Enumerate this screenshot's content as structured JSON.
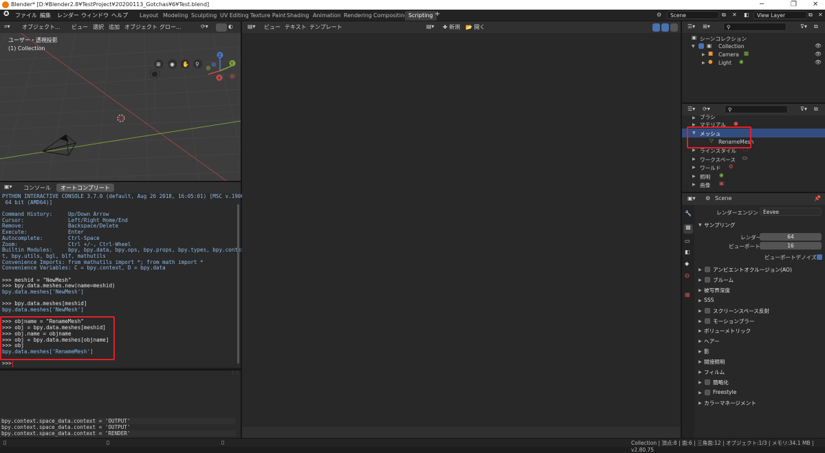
{
  "window": {
    "title": "Blender* [D:¥Blender2.8¥TestProject¥20200113_Gotchas¥6¥Test.blend]",
    "controls": [
      "─",
      "❐",
      "✕"
    ]
  },
  "menu": [
    "ファイル",
    "編集",
    "レンダー",
    "ウィンドウ",
    "ヘルプ"
  ],
  "workspaces": [
    "Layout",
    "Modeling",
    "Sculpting",
    "UV Editing",
    "Texture Paint",
    "Shading",
    "Animation",
    "Rendering",
    "Compositing",
    "Scripting"
  ],
  "active_workspace": "Scripting",
  "scene_field": "Scene",
  "view_layer_field": "View Layer",
  "viewport": {
    "mode": "オブジェクト...",
    "menus": [
      "ビュー",
      "選択",
      "追加",
      "オブジェクト"
    ],
    "transform": "グロー...",
    "title": "ユーザー・透視投影",
    "subtitle": "(1) Collection",
    "gizmo": {
      "x": "X",
      "y": "Y",
      "z": "Z"
    }
  },
  "console": {
    "tabs": [
      "コンソール",
      "オートコンプリート"
    ],
    "lines": [
      {
        "t": "PYTHON INTERACTIVE CONSOLE 3.7.0 (default, Aug 26 2018, 16:05:01) [MSC v.1900",
        "k": "o"
      },
      {
        "t": " 64 bit (AMD64)]",
        "k": "o"
      },
      {
        "t": "",
        "k": "o"
      },
      {
        "t": "Command History:     Up/Down Arrow",
        "k": "o"
      },
      {
        "t": "Cursor:              Left/Right Home/End",
        "k": "o"
      },
      {
        "t": "Remove:              Backspace/Delete",
        "k": "o"
      },
      {
        "t": "Execute:             Enter",
        "k": "o"
      },
      {
        "t": "Autocomplete:        Ctrl-Space",
        "k": "o"
      },
      {
        "t": "Zoom:                Ctrl +/-, Ctrl-Wheel",
        "k": "o"
      },
      {
        "t": "Builtin Modules:     bpy, bpy.data, bpy.ops, bpy.props, bpy.types, bpy.contex",
        "k": "o"
      },
      {
        "t": "t, bpy.utils, bgl, blf, mathutils",
        "k": "o"
      },
      {
        "t": "Convenience Imports: from mathutils import *; from math import *",
        "k": "o"
      },
      {
        "t": "Convenience Variables: C = bpy.context, D = bpy.data",
        "k": "o"
      },
      {
        "t": "",
        "k": "o"
      },
      {
        "t": ">>> meshid = \"NewMesh\"",
        "k": "i"
      },
      {
        "t": ">>> bpy.data.meshes.new(name=meshid)",
        "k": "i"
      },
      {
        "t": "bpy.data.meshes['NewMesh']",
        "k": "o"
      },
      {
        "t": "",
        "k": "o"
      },
      {
        "t": ">>> bpy.data.meshes[meshid]",
        "k": "i"
      },
      {
        "t": "bpy.data.meshes['NewMesh']",
        "k": "o"
      },
      {
        "t": "",
        "k": "o"
      },
      {
        "t": ">>> objname = \"RenameMesh\"",
        "k": "i"
      },
      {
        "t": ">>> obj = bpy.data.meshes[meshid]",
        "k": "i"
      },
      {
        "t": ">>> obj.name = objname",
        "k": "i"
      },
      {
        "t": ">>> obj = bpy.data.meshes[objname]",
        "k": "i"
      },
      {
        "t": ">>> obj",
        "k": "i"
      },
      {
        "t": "bpy.data.meshes['RenameMesh']",
        "k": "o"
      },
      {
        "t": "",
        "k": "o"
      },
      {
        "t": ">>> ",
        "k": "i"
      }
    ]
  },
  "info_log": [
    "bpy.context.space_data.context = 'OUTPUT'",
    "bpy.context.space_data.context = 'OUTPUT'",
    "bpy.context.space_data.context = 'RENDER'"
  ],
  "text_editor": {
    "menus": [
      "ビュー",
      "テキスト",
      "テンプレート"
    ],
    "new_label": "新規",
    "open_label": "開く"
  },
  "outliner": {
    "root": "シーンコレクション",
    "collection": "Collection",
    "items": [
      "Camera",
      "Light"
    ]
  },
  "data_browser": {
    "items": [
      "ブラシ",
      "マテリアル",
      "メッシュ",
      "ラインスタイル",
      "ワークスペース",
      "ワールド",
      "照明",
      "画像"
    ],
    "child": "RenameMesh"
  },
  "properties": {
    "scene": "Scene",
    "render_engine_label": "レンダーエンジン",
    "render_engine_value": "Eevee",
    "sampling": "サンプリング",
    "render_label": "レンダー",
    "render_value": "64",
    "viewport_label": "ビューポート",
    "viewport_value": "16",
    "denoise_label": "ビューポートデノイズ",
    "panels": [
      {
        "label": "アンビエントオクルージョン(AO)",
        "check": true
      },
      {
        "label": "ブルーム",
        "check": true
      },
      {
        "label": "被写界深度",
        "check": false
      },
      {
        "label": "SSS",
        "check": false
      },
      {
        "label": "スクリーンスペース反射",
        "check": true
      },
      {
        "label": "モーションブラー",
        "check": true
      },
      {
        "label": "ボリューメトリック",
        "check": false
      },
      {
        "label": "ヘアー",
        "check": false
      },
      {
        "label": "影",
        "check": false
      },
      {
        "label": "間接照明",
        "check": false
      },
      {
        "label": "フィルム",
        "check": false
      },
      {
        "label": "簡略化",
        "check": true
      },
      {
        "label": "Freestyle",
        "check": true
      },
      {
        "label": "カラーマネージメント",
        "check": false
      }
    ]
  },
  "status_bar": "Collection | 頂点:8 | 面:6 | 三角面:12 | オブジェクト:1/3 | メモリ:34.1 MB | v2.80.75",
  "colors": {
    "highlight": "#e2202a",
    "accent": "#4772b3",
    "output_text": "#8ebae8"
  }
}
